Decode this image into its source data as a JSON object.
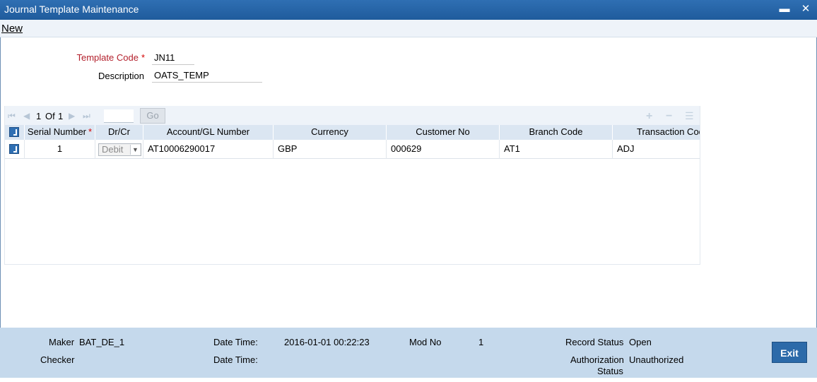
{
  "window": {
    "title": "Journal Template Maintenance",
    "minimize_icon": "minimize-icon",
    "close_icon": "close-icon"
  },
  "menu": {
    "new_label": "New"
  },
  "form": {
    "template_code_label": "Template Code",
    "template_code_value": "JN11",
    "description_label": "Description",
    "description_value": "OATS_TEMP"
  },
  "grid": {
    "pager": {
      "current": "1",
      "of_label": "Of",
      "total": "1",
      "go_label": "Go"
    },
    "toolbar_icons": [
      "add-row-icon",
      "delete-row-icon",
      "single-view-icon"
    ],
    "columns": [
      "Serial Number",
      "Dr/Cr",
      "Account/GL Number",
      "Currency",
      "Customer No",
      "Branch Code",
      "Transaction Code"
    ],
    "rows": [
      {
        "serial": "1",
        "drcr": "Debit",
        "account": "AT10006290017",
        "currency": "GBP",
        "customer": "000629",
        "branch": "AT1",
        "txn_code": "ADJ"
      }
    ]
  },
  "footer": {
    "maker_label": "Maker",
    "maker_value": "BAT_DE_1",
    "checker_label": "Checker",
    "datetime_label": "Date Time:",
    "maker_datetime": "2016-01-01 00:22:23",
    "checker_datetime_label": "Date Time:",
    "mod_no_label": "Mod No",
    "mod_no_value": "1",
    "record_status_label": "Record Status",
    "record_status_value": "Open",
    "auth_status_label_1": "Authorization",
    "auth_status_label_2": "Status",
    "auth_status_value": "Unauthorized",
    "exit_label": "Exit"
  },
  "colors": {
    "titlebar": "#1f5b9c",
    "footer": "#c5d9ec",
    "header_row": "#dbe6f2",
    "required": "#b3202c"
  }
}
